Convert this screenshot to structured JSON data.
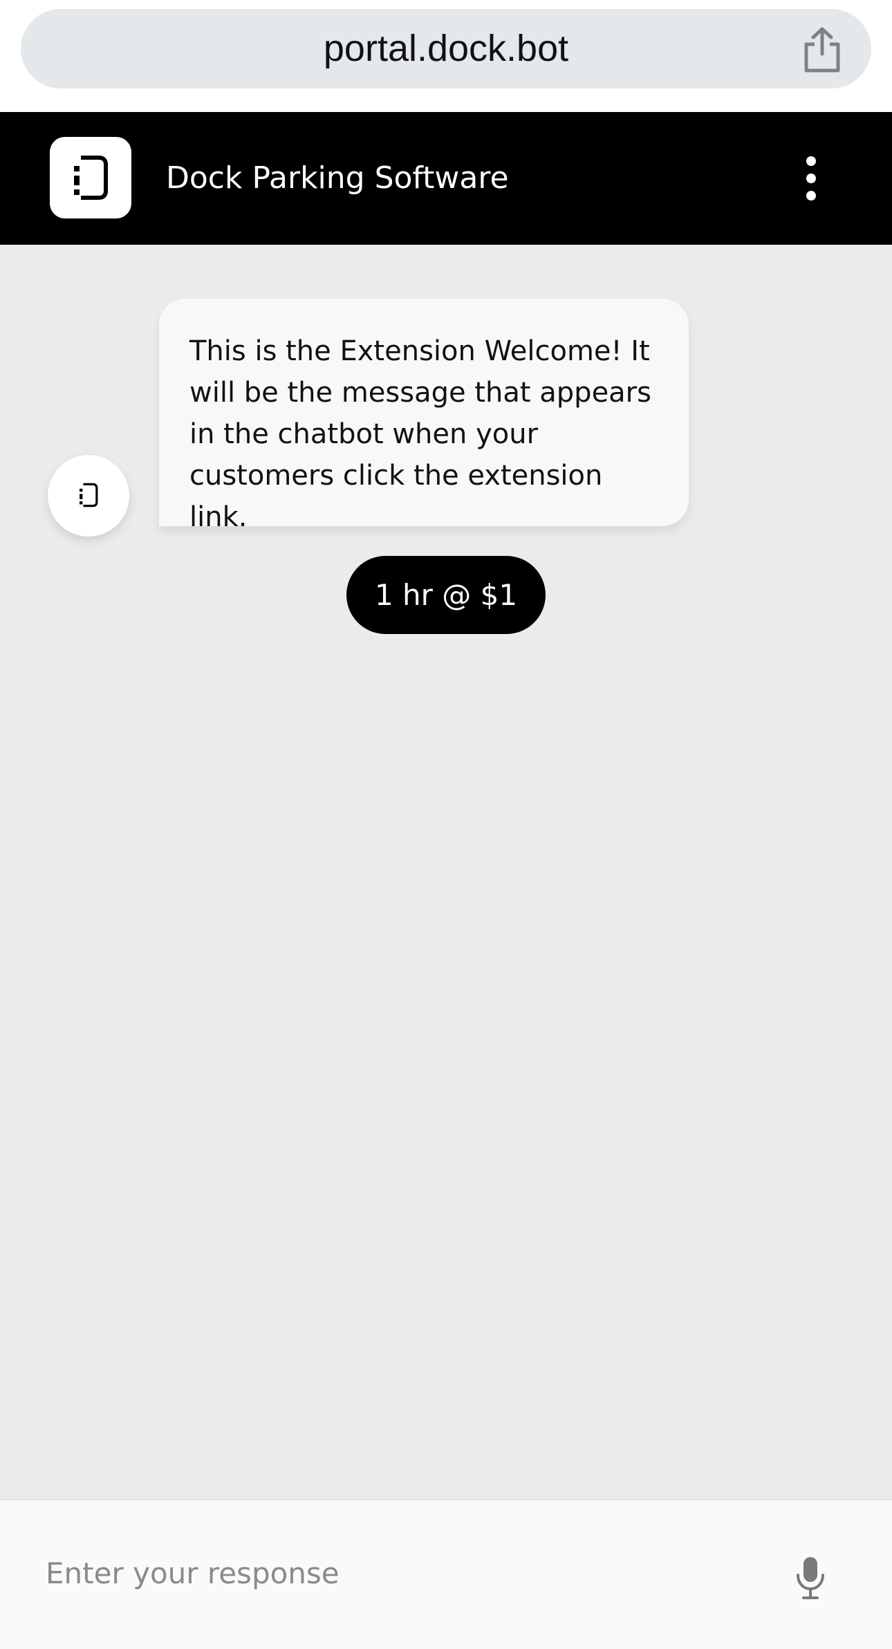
{
  "browser": {
    "url": "portal.dock.bot",
    "share_icon": "share-icon"
  },
  "header": {
    "logo_icon": "dock-logo-icon",
    "title": "Dock Parking Software",
    "menu_icon": "more-vertical-icon"
  },
  "chat": {
    "avatar_icon": "dock-logo-icon",
    "messages": [
      {
        "sender": "bot",
        "text": "This is the Extension Welcome! It will be the message that appears in the chatbot when your customers click the extension link."
      }
    ],
    "quick_replies": [
      {
        "label": "1 hr @ $1"
      }
    ]
  },
  "composer": {
    "placeholder": "Enter your response",
    "value": "",
    "mic_icon": "microphone-icon"
  },
  "colors": {
    "header_bg": "#000000",
    "chat_bg": "#ebebeb",
    "bubble_bg": "#f8f8f8",
    "quick_reply_bg": "#000000",
    "url_pill_bg": "#e5e8eb"
  }
}
